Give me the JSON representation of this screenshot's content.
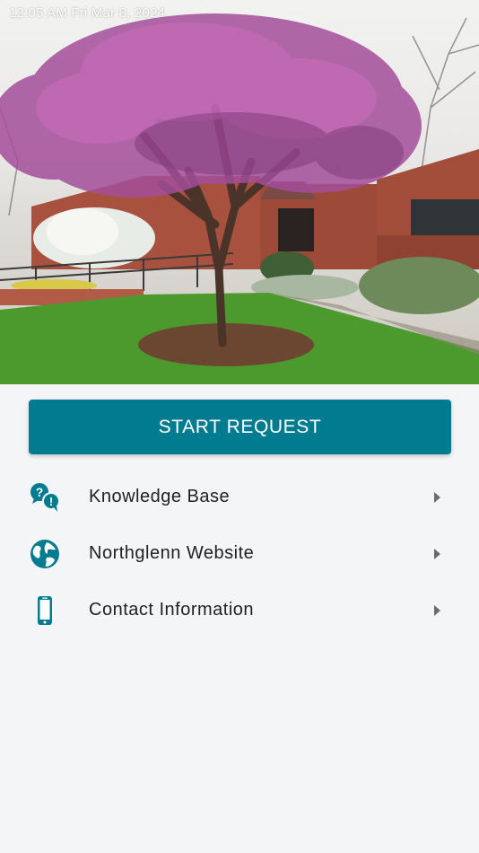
{
  "status_bar": {
    "time_date": "12:05 AM   Fri Mar 8, 2024"
  },
  "hero": {
    "image_alt": "Northglenn city building with blooming redbud tree"
  },
  "start_request": {
    "label": "START REQUEST"
  },
  "menu": {
    "items": [
      {
        "label": "Knowledge Base",
        "icon": "question-bubbles-icon"
      },
      {
        "label": "Northglenn Website",
        "icon": "globe-icon"
      },
      {
        "label": "Contact Information",
        "icon": "phone-icon"
      }
    ]
  },
  "colors": {
    "accent": "#007b8f",
    "background": "#f4f5f7",
    "text": "#212121"
  }
}
